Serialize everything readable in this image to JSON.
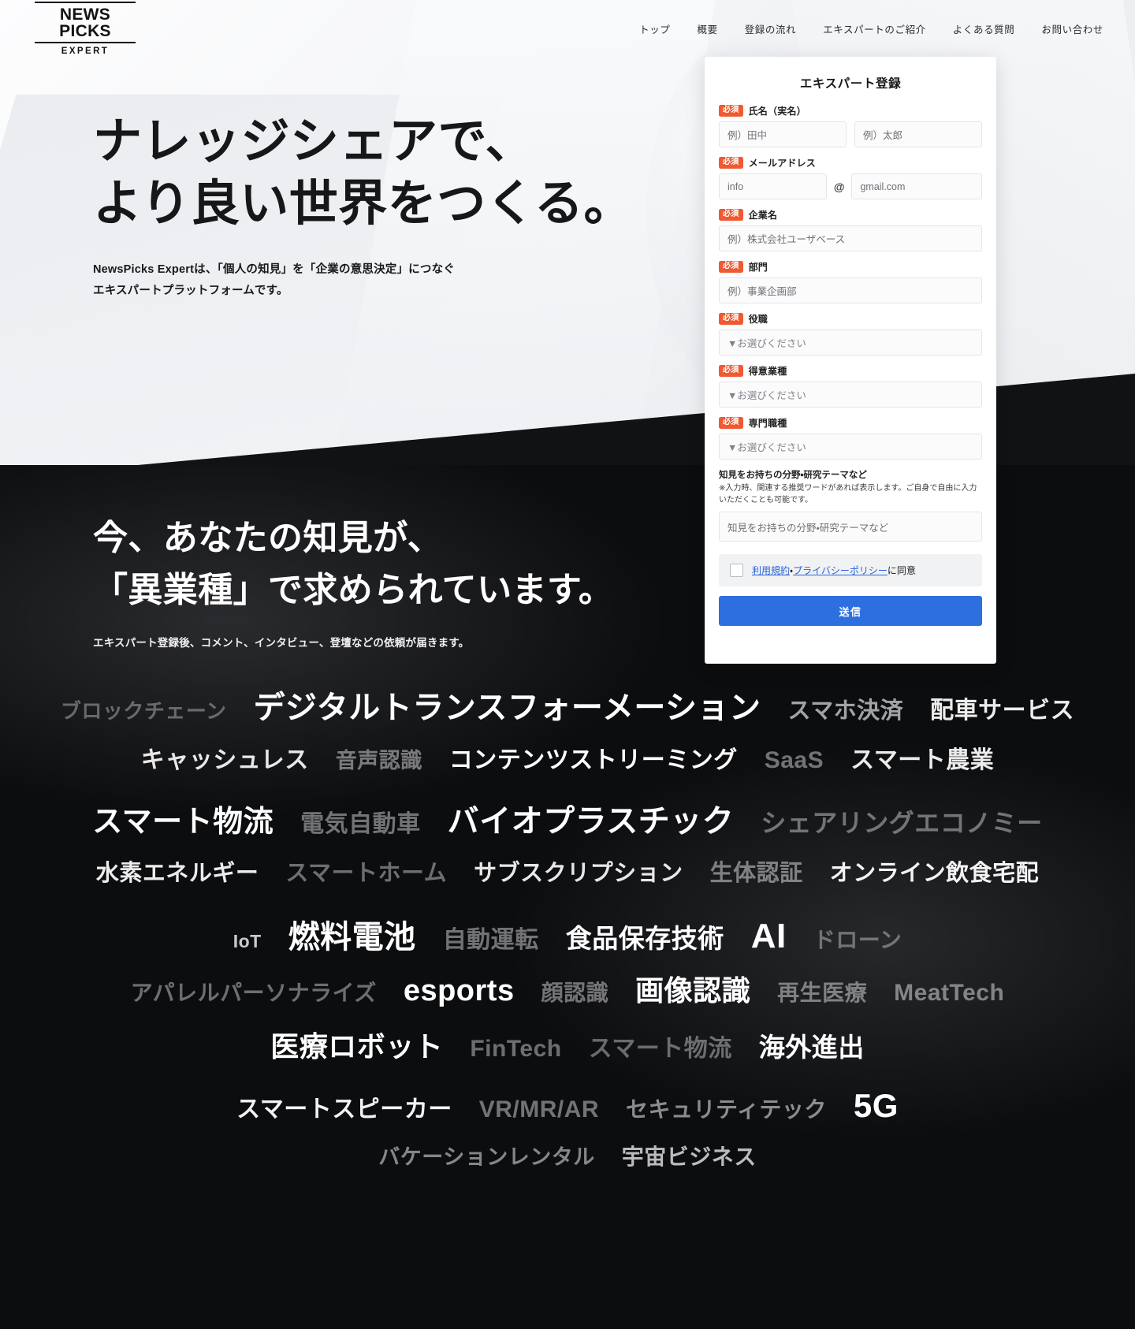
{
  "header": {
    "logo": {
      "main": "NEWS PICKS",
      "sub": "EXPERT"
    },
    "nav": [
      {
        "label": "トップ"
      },
      {
        "label": "概要"
      },
      {
        "label": "登録の流れ"
      },
      {
        "label": "エキスパートのご紹介"
      },
      {
        "label": "よくある質問"
      },
      {
        "label": "お問い合わせ"
      }
    ]
  },
  "hero": {
    "title_line1": "ナレッジシェアで、",
    "title_line2": "より良い世界をつくる。",
    "sub_line1": "NewsPicks Expertは、「個人の知見」を「企業の意思決定」につなぐ",
    "sub_line2": "エキスパートプラットフォームです。"
  },
  "dark": {
    "title_line1": "今、あなたの知見が、",
    "title_line2": "「異業種」で求められています。",
    "sub": "エキスパート登録後、コメント、インタビュー、登壇などの依頼が届きます。"
  },
  "form": {
    "title": "エキスパート登録",
    "required_badge": "必須",
    "fields": [
      {
        "label": "氏名（実名）",
        "required": true,
        "type": "name",
        "placeholder_last": "例）田中",
        "placeholder_first": "例）太郎"
      },
      {
        "label": "メールアドレス",
        "required": true,
        "type": "email",
        "placeholder_local": "info",
        "at_symbol": "@",
        "placeholder_domain": "gmail.com"
      },
      {
        "label": "企業名",
        "required": true,
        "type": "text",
        "placeholder": "例）株式会社ユーザベース"
      },
      {
        "label": "部門",
        "required": true,
        "type": "text",
        "placeholder": "例）事業企画部"
      },
      {
        "label": "役職",
        "required": true,
        "type": "select",
        "placeholder": "▼お選びください"
      },
      {
        "label": "得意業種",
        "required": true,
        "type": "select",
        "placeholder": "▼お選びください"
      },
      {
        "label": "専門職種",
        "required": true,
        "type": "select",
        "placeholder": "▼お選びください"
      }
    ],
    "expertise": {
      "label": "知見をお持ちの分野・研究テーマなど",
      "note": "※入力時、関連する推奨ワードがあれば表示します。ご自身で自由に入力いただくことも可能です。",
      "placeholder": "知見をお持ちの分野・研究テーマなど"
    },
    "agreement": {
      "link_terms": "利用規約",
      "separator": "・",
      "link_privacy": "プライバシーポリシー",
      "suffix": "に同意",
      "checked": false
    },
    "submit_label": "送信",
    "accent_color": "#2e6fe0",
    "required_color": "#ef5a32",
    "link_color": "#2a62d8"
  },
  "keyword_cloud": {
    "rows": [
      [
        {
          "text": "ブロックチェーン",
          "size": 26,
          "opacity": 0.34
        },
        {
          "text": "デジタルトランスフォーメーション",
          "size": 40,
          "opacity": 1.0
        },
        {
          "text": "スマホ決済",
          "size": 29,
          "opacity": 0.62
        },
        {
          "text": "配車サービス",
          "size": 30,
          "opacity": 0.92
        }
      ],
      [
        {
          "text": "キャッシュレス",
          "size": 30,
          "opacity": 0.9
        },
        {
          "text": "音声認識",
          "size": 27,
          "opacity": 0.44
        },
        {
          "text": "コンテンツストリーミング",
          "size": 30,
          "opacity": 1.0
        },
        {
          "text": "SaaS",
          "size": 30,
          "opacity": 0.42
        },
        {
          "text": "スマート農業",
          "size": 30,
          "opacity": 0.92
        }
      ],
      [
        {
          "text": "スマート物流",
          "size": 38,
          "opacity": 1.0
        },
        {
          "text": "電気自動車",
          "size": 30,
          "opacity": 0.42
        },
        {
          "text": "バイオプラスチック",
          "size": 40,
          "opacity": 1.0
        },
        {
          "text": "シェアリングエコノミー",
          "size": 32,
          "opacity": 0.4
        }
      ],
      [
        {
          "text": "水素エネルギー",
          "size": 29,
          "opacity": 0.92
        },
        {
          "text": "スマートホーム",
          "size": 29,
          "opacity": 0.4
        },
        {
          "text": "サブスクリプション",
          "size": 29,
          "opacity": 0.9
        },
        {
          "text": "生体認証",
          "size": 29,
          "opacity": 0.45
        },
        {
          "text": "オンライン飲食宅配",
          "size": 29,
          "opacity": 0.95
        }
      ],
      [
        {
          "text": "IoT",
          "size": 23,
          "opacity": 0.78
        },
        {
          "text": "燃料電池",
          "size": 40,
          "opacity": 1.0
        },
        {
          "text": "自動運転",
          "size": 30,
          "opacity": 0.42
        },
        {
          "text": "食品保存技術",
          "size": 33,
          "opacity": 1.0
        },
        {
          "text": "AI",
          "size": 44,
          "opacity": 1.0
        },
        {
          "text": "ドローン",
          "size": 28,
          "opacity": 0.36
        }
      ],
      [
        {
          "text": "アパレルパーソナライズ",
          "size": 28,
          "opacity": 0.4
        },
        {
          "text": "esports",
          "size": 38,
          "opacity": 1.0
        },
        {
          "text": "顔認識",
          "size": 28,
          "opacity": 0.42
        },
        {
          "text": "画像認識",
          "size": 36,
          "opacity": 1.0
        },
        {
          "text": "再生医療",
          "size": 28,
          "opacity": 0.44
        },
        {
          "text": "MeatTech",
          "size": 30,
          "opacity": 0.45
        }
      ],
      [
        {
          "text": "医療ロボット",
          "size": 36,
          "opacity": 1.0
        },
        {
          "text": "FinTech",
          "size": 30,
          "opacity": 0.4
        },
        {
          "text": "スマート物流",
          "size": 30,
          "opacity": 0.38
        },
        {
          "text": "海外進出",
          "size": 33,
          "opacity": 1.0
        }
      ],
      [
        {
          "text": "スマートスピーカー",
          "size": 30,
          "opacity": 0.95
        },
        {
          "text": "VR/MR/AR",
          "size": 30,
          "opacity": 0.42
        },
        {
          "text": "セキュリティテック",
          "size": 28,
          "opacity": 0.52
        },
        {
          "text": "5G",
          "size": 42,
          "opacity": 1.0
        }
      ],
      [
        {
          "text": "バケーションレンタル",
          "size": 27,
          "opacity": 0.5
        },
        {
          "text": "宇宙ビジネス",
          "size": 28,
          "opacity": 0.72
        }
      ]
    ]
  }
}
